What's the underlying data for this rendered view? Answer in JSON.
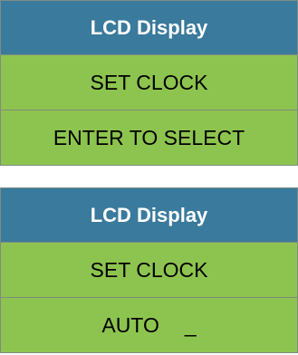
{
  "panels": [
    {
      "header": "LCD Display",
      "line1": "SET CLOCK",
      "line2": "ENTER TO SELECT"
    },
    {
      "header": "LCD Display",
      "line1": "SET CLOCK",
      "line2": "AUTO",
      "cursor": "_"
    }
  ],
  "colors": {
    "header_bg": "#3a7a9c",
    "screen_bg": "#8dc44f"
  }
}
